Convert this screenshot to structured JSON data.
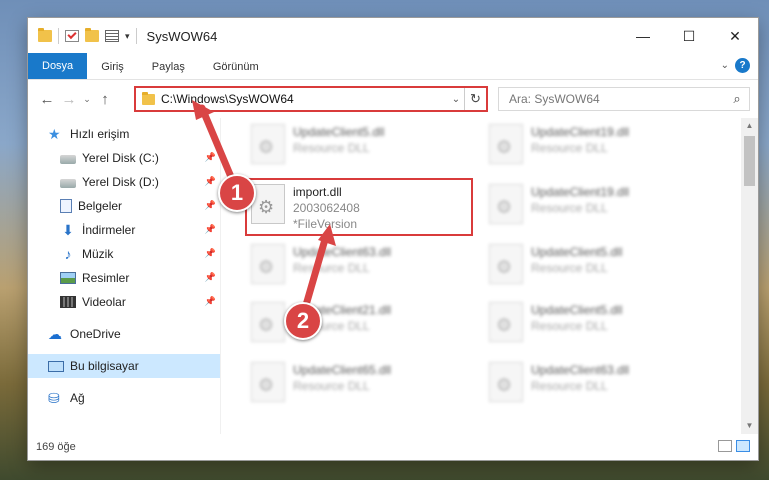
{
  "window": {
    "title": "SysWOW64",
    "minimize": "—",
    "maximize": "☐",
    "close": "✕"
  },
  "ribbon": {
    "tabs": [
      "Dosya",
      "Giriş",
      "Paylaş",
      "Görünüm"
    ],
    "help": "?"
  },
  "nav": {
    "back": "←",
    "forward": "→",
    "recent": "⌄",
    "up": "↑",
    "address": "C:\\Windows\\SysWOW64",
    "search_placeholder": "Ara: SysWOW64"
  },
  "sidebar": {
    "items": [
      {
        "label": "Hızlı erişim",
        "icon": "star-icon"
      },
      {
        "label": "Yerel Disk (C:)",
        "icon": "disk-icon",
        "pinned": true
      },
      {
        "label": "Yerel Disk (D:)",
        "icon": "disk-icon",
        "pinned": true
      },
      {
        "label": "Belgeler",
        "icon": "document-icon",
        "pinned": true
      },
      {
        "label": "İndirmeler",
        "icon": "download-icon",
        "pinned": true
      },
      {
        "label": "Müzik",
        "icon": "music-icon",
        "pinned": true
      },
      {
        "label": "Resimler",
        "icon": "pictures-icon",
        "pinned": true
      },
      {
        "label": "Videolar",
        "icon": "videos-icon",
        "pinned": true
      },
      {
        "label": "OneDrive",
        "icon": "cloud-icon"
      },
      {
        "label": "Bu bilgisayar",
        "icon": "computer-icon",
        "selected": true
      },
      {
        "label": "Ağ",
        "icon": "network-icon"
      }
    ]
  },
  "files": {
    "highlighted": {
      "name": "import.dll",
      "version": "2003062408",
      "desc": "*FileVersion"
    },
    "blurred": [
      {
        "name": "UpdateClient5.dll",
        "desc": "Resource DLL"
      },
      {
        "name": "UpdateClient19.dll",
        "desc": "Resource DLL"
      },
      {
        "name": "UpdateClient19.dll",
        "desc": "Resource DLL"
      },
      {
        "name": "UpdateClient63.dll",
        "desc": "Resource DLL"
      },
      {
        "name": "UpdateClient5.dll",
        "desc": "Resource DLL"
      },
      {
        "name": "UpdateClient21.dll",
        "desc": "Resource DLL"
      },
      {
        "name": "UpdateClient5.dll",
        "desc": "Resource DLL"
      },
      {
        "name": "UpdateClient65.dll",
        "desc": "Resource DLL"
      },
      {
        "name": "UpdateClient63.dll",
        "desc": "Resource DLL"
      }
    ]
  },
  "status": {
    "count": "169 öğe"
  },
  "annotations": {
    "step1": "1",
    "step2": "2",
    "color": "#d94545"
  }
}
